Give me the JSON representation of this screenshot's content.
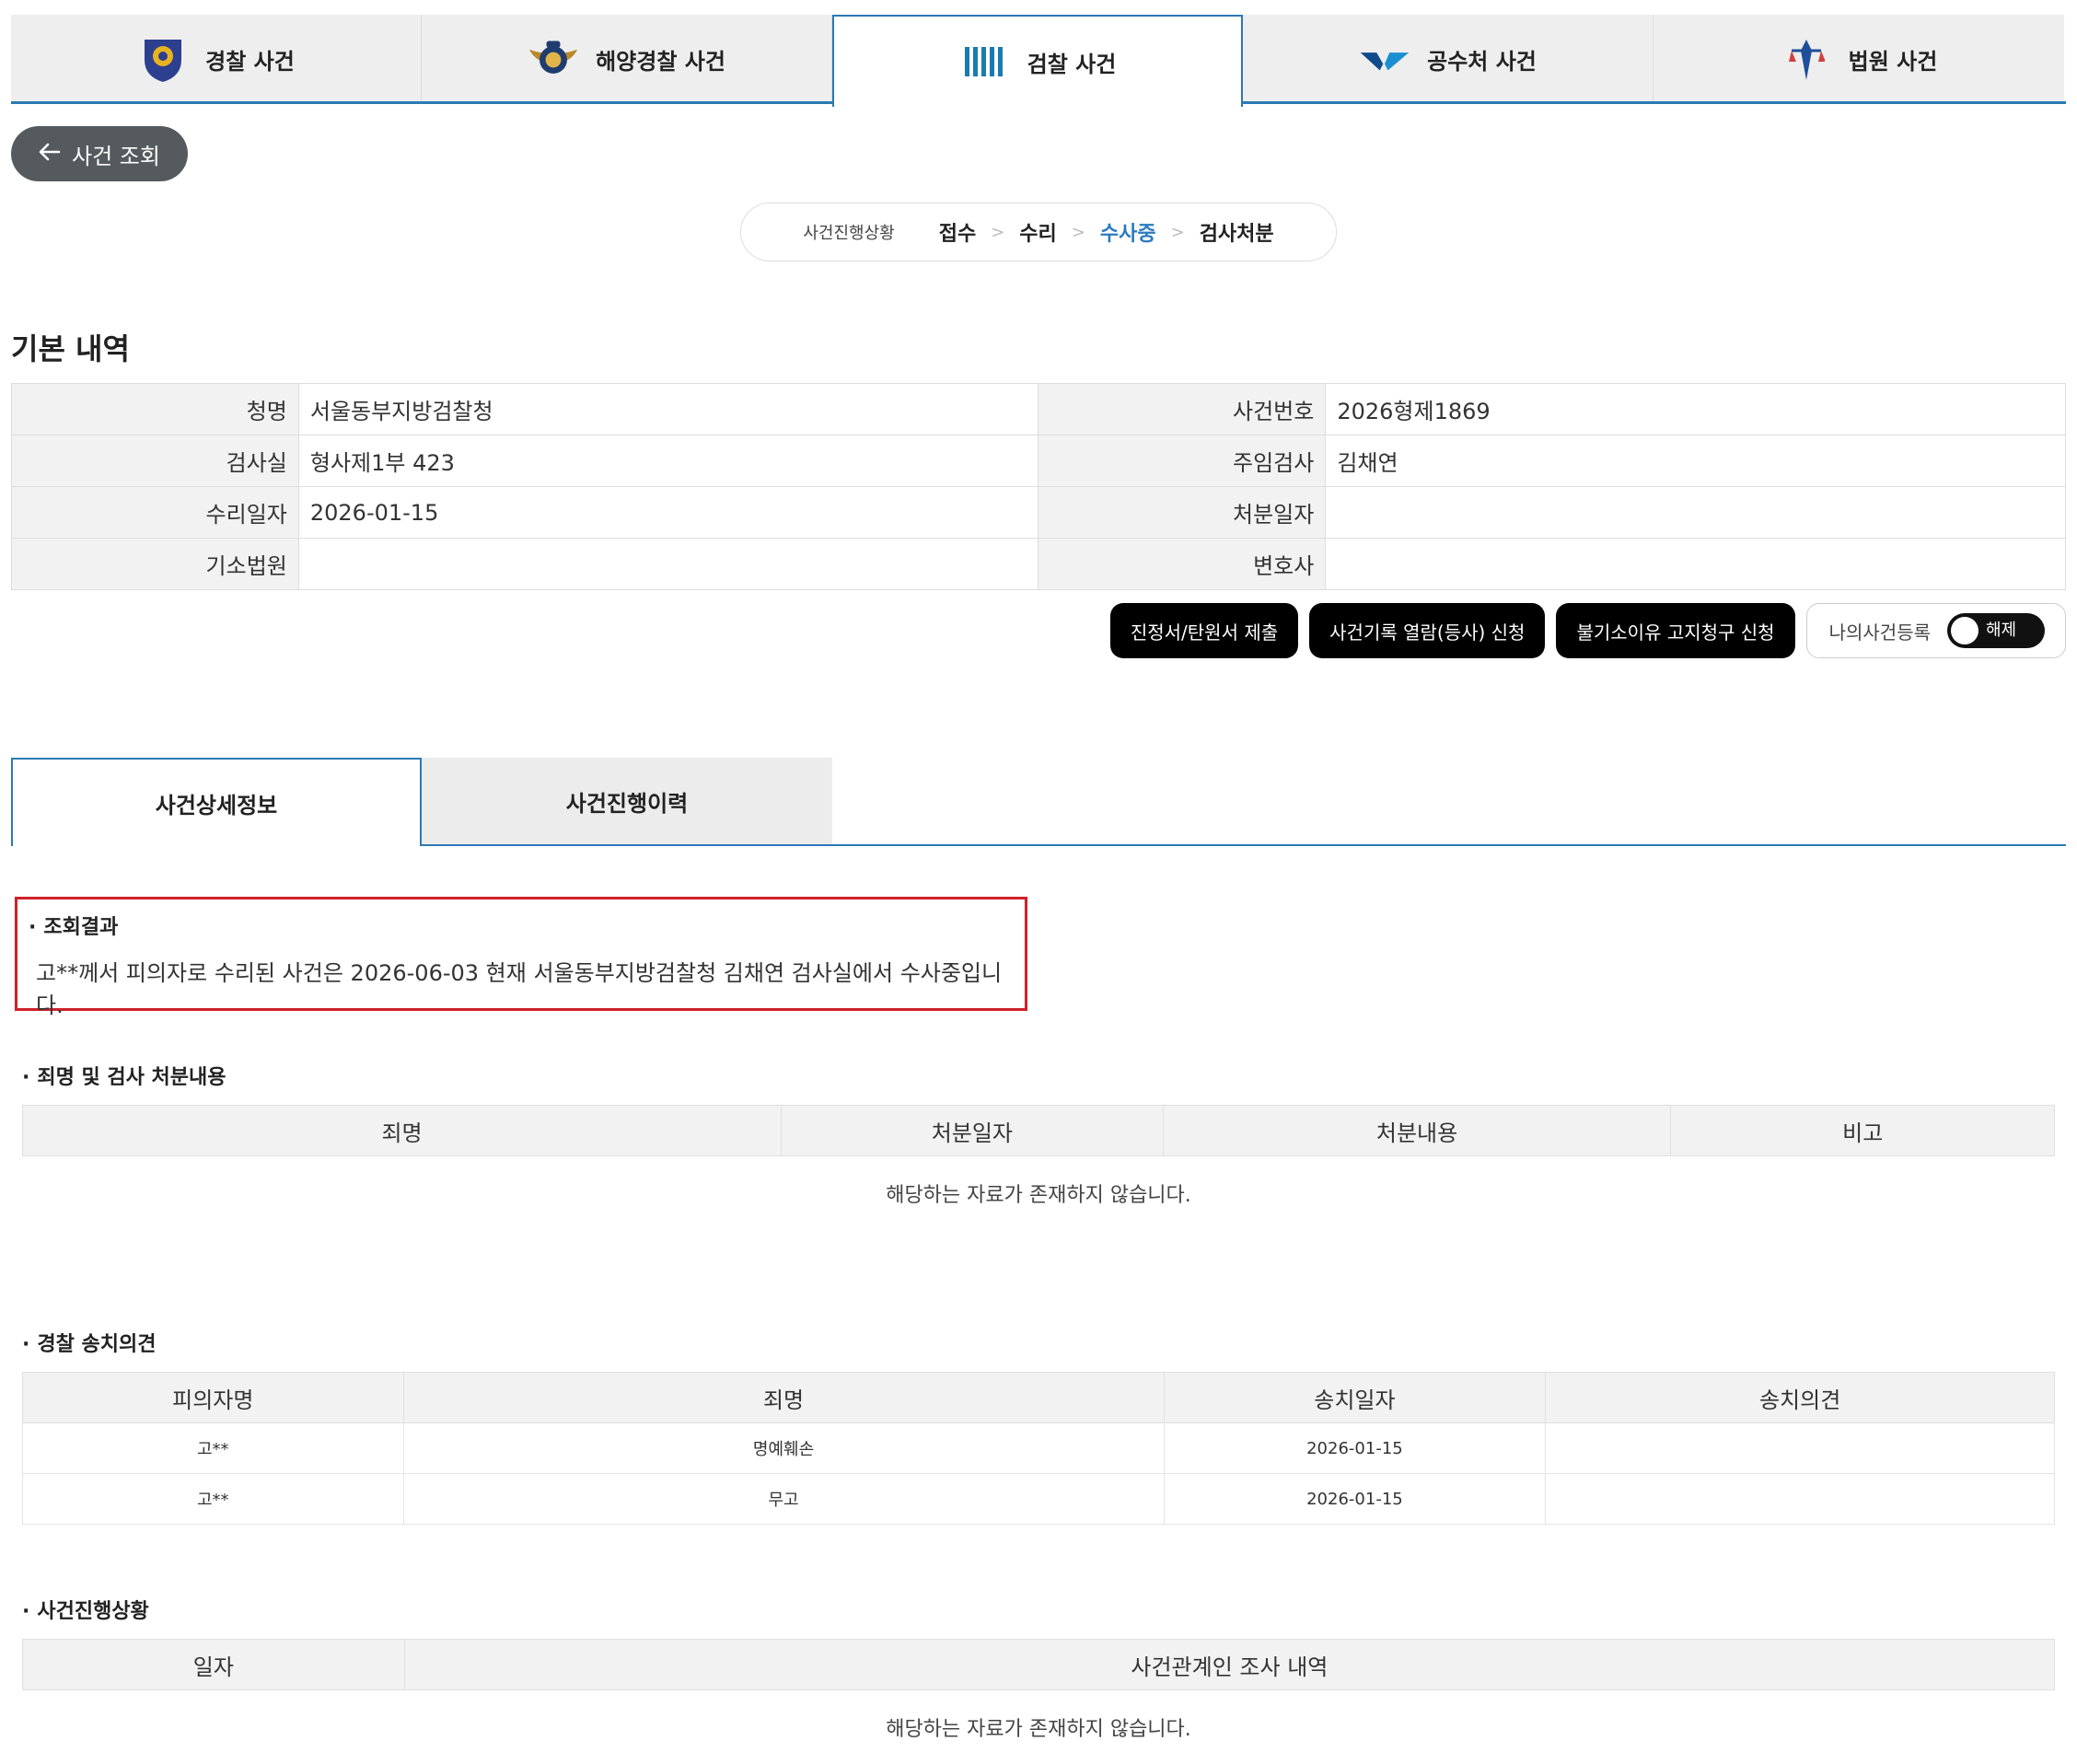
{
  "agency_tabs": [
    {
      "label": "경찰 사건",
      "icon": "police-emblem-icon"
    },
    {
      "label": "해양경찰 사건",
      "icon": "coast-guard-emblem-icon"
    },
    {
      "label": "검찰 사건",
      "icon": "prosecution-emblem-icon"
    },
    {
      "label": "공수처 사건",
      "icon": "cio-emblem-icon"
    },
    {
      "label": "법원 사건",
      "icon": "court-emblem-icon"
    }
  ],
  "back_button": {
    "label": "사건 조회",
    "icon": "arrow-left-icon"
  },
  "progress": {
    "label": "사건진행상황",
    "steps": [
      "접수",
      "수리",
      "수사중",
      "검사처분"
    ],
    "separator": ">",
    "current_index": 2,
    "current_color": "#2b7bbd"
  },
  "basic": {
    "title": "기본 내역",
    "rows": [
      {
        "l_label": "청명",
        "l_value": "서울동부지방검찰청",
        "r_label": "사건번호",
        "r_value": "2026형제1869"
      },
      {
        "l_label": "검사실",
        "l_value": "형사제1부 423",
        "r_label": "주임검사",
        "r_value": "김채연"
      },
      {
        "l_label": "수리일자",
        "l_value": "2026-01-15",
        "r_label": "처분일자",
        "r_value": ""
      },
      {
        "l_label": "기소법원",
        "l_value": "",
        "r_label": "변호사",
        "r_value": ""
      }
    ]
  },
  "actions": {
    "petition": "진정서/탄원서 제출",
    "records": "사건기록 열람(등사) 신청",
    "notice": "불기소이유 고지청구 신청",
    "my_case": "나의사건등록",
    "toggle_label": "해제"
  },
  "detail_tabs": [
    "사건상세정보",
    "사건진행이력"
  ],
  "result": {
    "bullet": "·",
    "title": "조회결과",
    "text": "고**께서 피의자로 수리된 사건은 2026-06-03 현재 서울동부지방검찰청 김채연 검사실에서 수사중입니다."
  },
  "charges": {
    "title": "죄명 및 검사 처분내용",
    "headers": [
      "죄명",
      "처분일자",
      "처분내용",
      "비고"
    ],
    "empty": "해당하는 자료가 존재하지 않습니다."
  },
  "police_opinion": {
    "title": "경찰 송치의견",
    "headers": [
      "피의자명",
      "죄명",
      "송치일자",
      "송치의견"
    ],
    "rows": [
      [
        "고**",
        "명예훼손",
        "2026-01-15",
        ""
      ],
      [
        "고**",
        "무고",
        "2026-01-15",
        ""
      ]
    ]
  },
  "case_progress": {
    "title": "사건진행상황",
    "headers": [
      "일자",
      "사건관계인 조사 내역"
    ],
    "empty": "해당하는 자료가 존재하지 않습니다."
  },
  "colors": {
    "accent": "#2b79b5",
    "highlight": "#d0202a",
    "button_dark": "#000000"
  }
}
